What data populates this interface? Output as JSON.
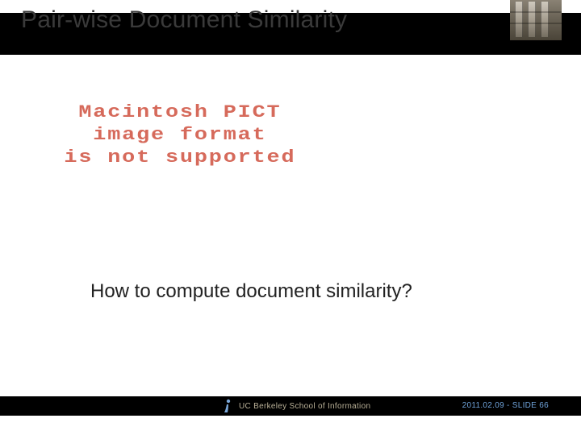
{
  "title": "Pair-wise Document Similarity",
  "pict_message": {
    "line1": "Macintosh PICT",
    "line2": "image format",
    "line3": "is not supported"
  },
  "body_question": "How to compute document similarity?",
  "footer": {
    "org": "UC Berkeley School of Information",
    "date": "2011.02.09",
    "slide_label": "- SLIDE",
    "slide_number": "66"
  }
}
